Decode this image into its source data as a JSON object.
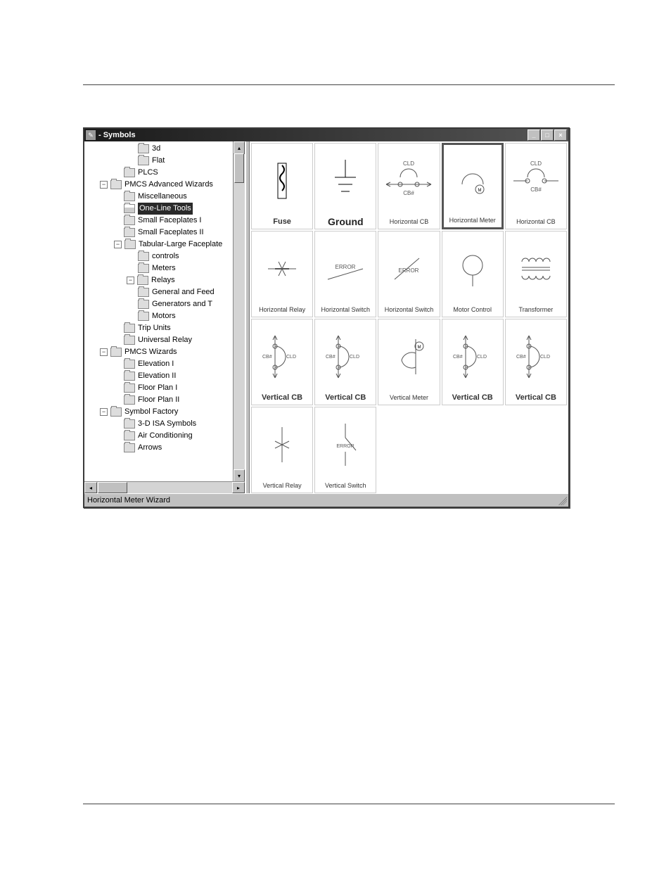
{
  "window": {
    "title": " - Symbols"
  },
  "tree": {
    "items": [
      {
        "level": "ind2",
        "label": "3d"
      },
      {
        "level": "ind2",
        "label": "Flat"
      },
      {
        "level": "ind1b",
        "label": "PLCS"
      },
      {
        "level": "ind0",
        "expander": "−",
        "label": "PMCS Advanced Wizards"
      },
      {
        "level": "ind1b",
        "label": "Miscellaneous"
      },
      {
        "level": "ind1b",
        "label": "One-Line Tools",
        "selected": true,
        "open": true
      },
      {
        "level": "ind1b",
        "label": "Small Faceplates I"
      },
      {
        "level": "ind1b",
        "label": "Small Faceplates II"
      },
      {
        "level": "ind1ex",
        "expander": "−",
        "label": "Tabular-Large Faceplate"
      },
      {
        "level": "ind2",
        "label": "controls"
      },
      {
        "level": "ind2",
        "label": "Meters"
      },
      {
        "level": "ind1b-ex",
        "expander": "−",
        "label": "Relays"
      },
      {
        "level": "ind2",
        "label": "General and Feed"
      },
      {
        "level": "ind2",
        "label": "Generators and T"
      },
      {
        "level": "ind2",
        "label": "Motors"
      },
      {
        "level": "ind1b",
        "label": "Trip Units"
      },
      {
        "level": "ind1b",
        "label": "Universal Relay"
      },
      {
        "level": "ind0",
        "expander": "−",
        "label": "PMCS Wizards"
      },
      {
        "level": "ind1b",
        "label": "Elevation I"
      },
      {
        "level": "ind1b",
        "label": "Elevation II"
      },
      {
        "level": "ind1b",
        "label": "Floor Plan I"
      },
      {
        "level": "ind1b",
        "label": "Floor Plan II"
      },
      {
        "level": "ind0",
        "expander": "−",
        "label": "Symbol Factory"
      },
      {
        "level": "ind1b",
        "label": "3-D ISA Symbols"
      },
      {
        "level": "ind1b",
        "label": "Air Conditioning"
      },
      {
        "level": "ind1b",
        "label": "Arrows"
      }
    ]
  },
  "symbols": [
    {
      "label": "Fuse",
      "style": "bold",
      "kind": "fuse"
    },
    {
      "label": "Ground",
      "style": "big",
      "kind": "ground"
    },
    {
      "label": "Horizontal CB",
      "sub": "CLD",
      "sub2": "CB#",
      "kind": "hcb1"
    },
    {
      "label": "Horizontal Meter",
      "kind": "hmeter",
      "selected": true
    },
    {
      "label": "Horizontal CB",
      "sub": "CLD",
      "sub2": "CB#",
      "kind": "hcb2"
    },
    {
      "label": "Horizontal Relay",
      "kind": "hrelay"
    },
    {
      "label": "Horizontal Switch",
      "sub": "ERROR",
      "kind": "hswitch"
    },
    {
      "label": "Horizontal Switch",
      "sub": "ERROR",
      "kind": "hswitch2"
    },
    {
      "label": "Motor Control",
      "kind": "motor"
    },
    {
      "label": "Transformer",
      "kind": "xfmr"
    },
    {
      "label": "Vertical CB",
      "style": "bold",
      "sub": "CB#",
      "sub2": "CLD",
      "kind": "vcb1"
    },
    {
      "label": "Vertical CB",
      "style": "bold",
      "sub": "CB#",
      "sub2": "CLD",
      "kind": "vcb2"
    },
    {
      "label": "Vertical Meter",
      "kind": "vmeter"
    },
    {
      "label": "Vertical CB",
      "style": "bold",
      "sub": "CB#",
      "sub2": "CLD",
      "kind": "vcb3"
    },
    {
      "label": "Vertical CB",
      "style": "bold",
      "sub": "CB#",
      "sub2": "CLD",
      "kind": "vcb4"
    },
    {
      "label": "Vertical Relay",
      "kind": "vrelay"
    },
    {
      "label": "Vertical Switch",
      "sub": "ERROR",
      "kind": "vswitch"
    }
  ],
  "status": "Horizontal Meter Wizard"
}
